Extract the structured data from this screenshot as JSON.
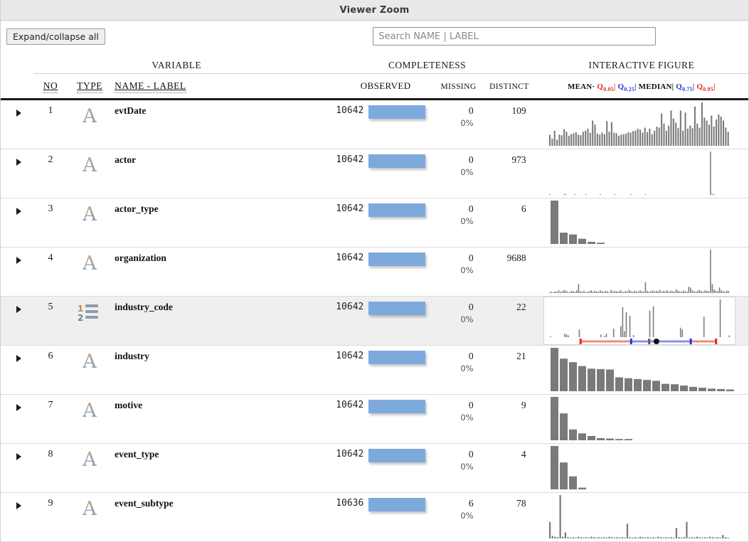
{
  "window": {
    "title": "Viewer Zoom"
  },
  "toolbar": {
    "expand_collapse_label": "Expand/collapse all",
    "search_placeholder": "Search NAME | LABEL",
    "search_value": ""
  },
  "group_headers": {
    "variable": "VARIABLE",
    "completeness": "COMPLETENESS",
    "interactive_figure": "INTERACTIVE FIGURE"
  },
  "columns": {
    "no": "NO",
    "type": "TYPE",
    "name_label": "NAME - LABEL",
    "observed": "OBSERVED",
    "missing": "MISSING",
    "distinct": "DISTINCT"
  },
  "legend": {
    "mean": "MEAN",
    "mean_dot": "·",
    "q05": "Q",
    "q05_sub": "0.05",
    "q25": "Q",
    "q25_sub": "0.25",
    "median": "MEDIAN",
    "q75": "Q",
    "q75_sub": "0.75",
    "q95": "Q",
    "q95_sub": "0.95",
    "sep": "|",
    "colors": {
      "quantile_outer": "#e8291c",
      "quantile_inner": "#2a34d8",
      "median": "#111111",
      "bar_fill": "#7ea9dc",
      "histogram": "#7a7a7a"
    }
  },
  "rows": [
    {
      "no": "1",
      "type_icon": "text-type-icon",
      "name": "evtDate",
      "observed": "10642",
      "observed_bar_pct": 100,
      "missing": "0",
      "missing_pct": "0%",
      "distinct": "109",
      "figure": {
        "type": "histogram",
        "align": "right",
        "values": [
          22,
          14,
          30,
          12,
          22,
          21,
          33,
          28,
          20,
          23,
          25,
          27,
          22,
          21,
          28,
          30,
          34,
          26,
          50,
          42,
          24,
          22,
          26,
          23,
          49,
          28,
          47,
          26,
          25,
          20,
          22,
          23,
          24,
          27,
          26,
          29,
          30,
          34,
          32,
          26,
          36,
          27,
          34,
          23,
          30,
          38,
          36,
          64,
          44,
          30,
          40,
          70,
          54,
          46,
          35,
          70,
          30,
          66,
          34,
          40,
          35,
          78,
          44,
          36,
          86,
          56,
          50,
          42,
          60,
          38,
          52,
          62,
          58,
          50,
          36,
          28
        ]
      }
    },
    {
      "no": "2",
      "type_icon": "text-type-icon",
      "name": "actor",
      "observed": "10642",
      "observed_bar_pct": 100,
      "missing": "0",
      "missing_pct": "0%",
      "distinct": "973",
      "figure": {
        "type": "histogram",
        "align": "stretch",
        "values": [
          1,
          0,
          0,
          0,
          0,
          0,
          0,
          0,
          2,
          1,
          0,
          0,
          0,
          0,
          1,
          0,
          0,
          0,
          0,
          0,
          1,
          0,
          0,
          0,
          0,
          0,
          0,
          0,
          1,
          0,
          0,
          0,
          0,
          0,
          0,
          0,
          1,
          0,
          0,
          0,
          0,
          0,
          0,
          0,
          0,
          1,
          0,
          0,
          0,
          0,
          0,
          0,
          0,
          1,
          0,
          0,
          0,
          0,
          0,
          0,
          0,
          0,
          0,
          0,
          0,
          0,
          0,
          0,
          0,
          0,
          0,
          0,
          0,
          0,
          0,
          0,
          0,
          0,
          0,
          0,
          0,
          0,
          0,
          0,
          0,
          0,
          0,
          0,
          0,
          92,
          2,
          1,
          0,
          0,
          0,
          0,
          0,
          0,
          0,
          0
        ]
      }
    },
    {
      "no": "3",
      "type_icon": "text-type-icon",
      "name": "actor_type",
      "observed": "10642",
      "observed_bar_pct": 100,
      "missing": "0",
      "missing_pct": "0%",
      "distinct": "6",
      "figure": {
        "type": "bar",
        "align": "left",
        "values": [
          100,
          26,
          22,
          12,
          5,
          3
        ]
      }
    },
    {
      "no": "4",
      "type_icon": "text-type-icon",
      "name": "organization",
      "observed": "10642",
      "observed_bar_pct": 100,
      "missing": "0",
      "missing_pct": "0%",
      "distinct": "9688",
      "figure": {
        "type": "histogram",
        "align": "stretch",
        "values": [
          2,
          3,
          2,
          4,
          3,
          6,
          3,
          4,
          7,
          5,
          3,
          2,
          5,
          4,
          3,
          6,
          20,
          4,
          3,
          5,
          2,
          3,
          4,
          6,
          3,
          5,
          4,
          3,
          6,
          4,
          3,
          5,
          4,
          2,
          7,
          3,
          5,
          4,
          3,
          6,
          4,
          2,
          5,
          3,
          7,
          4,
          3,
          5,
          4,
          3,
          6,
          4,
          3,
          24,
          5,
          3,
          4,
          6,
          3,
          5,
          4,
          7,
          3,
          5,
          4,
          6,
          3,
          5,
          4,
          3,
          8,
          5,
          4,
          3,
          6,
          4,
          3,
          14,
          12,
          6,
          4,
          3,
          5,
          7,
          4,
          3,
          6,
          5,
          4,
          96,
          20,
          8,
          5,
          4,
          12,
          6,
          4,
          3,
          5,
          4
        ]
      }
    },
    {
      "no": "5",
      "type_icon": "numeric-type-icon",
      "name": "industry_code",
      "highlighted": true,
      "observed": "10642",
      "observed_bar_pct": 100,
      "missing": "0",
      "missing_pct": "0%",
      "distinct": "22",
      "figure": {
        "type": "histogram-quantile",
        "align": "stretch",
        "values": [
          2,
          0,
          0,
          0,
          0,
          0,
          0,
          0,
          8,
          6,
          4,
          0,
          0,
          0,
          0,
          0,
          18,
          0,
          0,
          0,
          0,
          0,
          0,
          0,
          0,
          0,
          0,
          0,
          6,
          0,
          3,
          8,
          0,
          0,
          0,
          20,
          0,
          0,
          0,
          26,
          70,
          14,
          58,
          0,
          50,
          0,
          5,
          0,
          0,
          0,
          0,
          0,
          0,
          0,
          0,
          62,
          0,
          72,
          0,
          0,
          0,
          0,
          0,
          0,
          0,
          0,
          0,
          0,
          0,
          0,
          0,
          0,
          22,
          18,
          0,
          0,
          0,
          0,
          0,
          0,
          0,
          0,
          0,
          0,
          0,
          48,
          0,
          0,
          0,
          0,
          0,
          0,
          0,
          0,
          88,
          0,
          0,
          0,
          0,
          4
        ],
        "quantile_bar": {
          "q05": 17,
          "q25": 45,
          "median": 55,
          "mean": 59,
          "q75": 78,
          "q95": 92
        }
      }
    },
    {
      "no": "6",
      "type_icon": "text-type-icon",
      "name": "industry",
      "observed": "10642",
      "observed_bar_pct": 100,
      "missing": "0",
      "missing_pct": "0%",
      "distinct": "21",
      "figure": {
        "type": "bar",
        "align": "left",
        "values": [
          100,
          75,
          67,
          58,
          52,
          51,
          50,
          32,
          30,
          28,
          26,
          24,
          17,
          16,
          13,
          10,
          8,
          6,
          5,
          4,
          3
        ]
      }
    },
    {
      "no": "7",
      "type_icon": "text-type-icon",
      "name": "motive",
      "observed": "10642",
      "observed_bar_pct": 100,
      "missing": "0",
      "missing_pct": "0%",
      "distinct": "9",
      "figure": {
        "type": "bar",
        "align": "left",
        "values": [
          100,
          62,
          25,
          16,
          10,
          5,
          4,
          3,
          3
        ]
      }
    },
    {
      "no": "8",
      "type_icon": "text-type-icon",
      "name": "event_type",
      "observed": "10642",
      "observed_bar_pct": 100,
      "missing": "0",
      "missing_pct": "0%",
      "distinct": "4",
      "figure": {
        "type": "bar",
        "align": "left",
        "values": [
          100,
          62,
          30,
          4
        ]
      }
    },
    {
      "no": "9",
      "type_icon": "text-type-icon",
      "name": "event_subtype",
      "observed": "10636",
      "observed_bar_pct": 100,
      "missing": "6",
      "missing_pct": "0%",
      "distinct": "78",
      "figure": {
        "type": "histogram",
        "align": "stretch",
        "values": [
          38,
          6,
          4,
          3,
          100,
          4,
          14,
          3,
          2,
          3,
          2,
          4,
          3,
          2,
          3,
          2,
          4,
          3,
          2,
          3,
          2,
          3,
          2,
          4,
          3,
          2,
          3,
          2,
          3,
          2,
          34,
          3,
          2,
          3,
          2,
          4,
          3,
          2,
          3,
          2,
          3,
          2,
          4,
          3,
          2,
          3,
          2,
          3,
          2,
          24,
          3,
          2,
          3,
          38,
          2,
          3,
          2,
          4,
          3,
          2,
          3,
          2,
          4,
          3,
          2,
          3,
          2,
          8,
          3,
          2
        ]
      }
    }
  ]
}
